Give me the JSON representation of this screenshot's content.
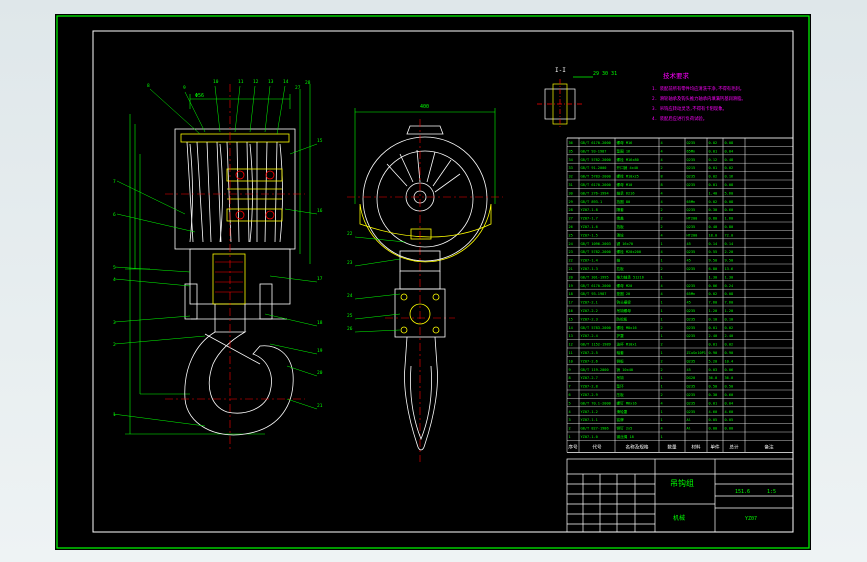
{
  "colors": {
    "background": "#000000",
    "outer_frame": "#00ff00",
    "inner_frame": "#ffffff",
    "geometry": "#ffffff",
    "dims": "#00ff00",
    "centerline": "#ff0000",
    "leader": "#00ff00",
    "title": "#00ff00",
    "tech": "#ff00ff",
    "highlight": "#ffff00",
    "section": "#ffffff"
  },
  "section_label": "I-I",
  "tech_requirements": {
    "title": "技术要求",
    "items": [
      "1. 装配前所有零件均应清洗干净,不得有毛刺。",
      "2. 滑轮轴承及钩头推力轴承内填满钙基润滑脂。",
      "3. 吊钩应转动灵活,不得有卡阻现象。",
      "4. 装配后应进行负荷试验。"
    ]
  },
  "bom": {
    "headers": [
      "序号",
      "代号",
      "名称及规格",
      "数量",
      "材料",
      "单件",
      "总计",
      "备注"
    ],
    "weight_header": "重量",
    "rows": [
      {
        "no": "36",
        "code": "GB/T 6170-2000",
        "name": "螺母 M16",
        "qty": "4",
        "mat": "Q235",
        "unit": "0.02",
        "total": "0.08"
      },
      {
        "no": "35",
        "code": "GB/T 93-1987",
        "name": "垫圈 16",
        "qty": "4",
        "mat": "65Mn",
        "unit": "0.01",
        "total": "0.04"
      },
      {
        "no": "34",
        "code": "GB/T 5782-2000",
        "name": "螺栓 M16x80",
        "qty": "4",
        "mat": "Q235",
        "unit": "0.12",
        "total": "0.48"
      },
      {
        "no": "33",
        "code": "GB/T 91-2000",
        "name": "开口销 4x40",
        "qty": "2",
        "mat": "Q215",
        "unit": "0.01",
        "total": "0.02"
      },
      {
        "no": "32",
        "code": "GB/T 5783-2000",
        "name": "螺栓 M10x25",
        "qty": "8",
        "mat": "Q235",
        "unit": "0.02",
        "total": "0.16"
      },
      {
        "no": "31",
        "code": "GB/T 6170-2000",
        "name": "螺母 M10",
        "qty": "8",
        "mat": "Q235",
        "unit": "0.01",
        "total": "0.08"
      },
      {
        "no": "30",
        "code": "GB/T 276-1994",
        "name": "轴承 6216",
        "qty": "4",
        "mat": "",
        "unit": "1.40",
        "total": "5.60"
      },
      {
        "no": "29",
        "code": "GB/T 893.1",
        "name": "挡圈 80",
        "qty": "4",
        "mat": "65Mn",
        "unit": "0.02",
        "total": "0.08"
      },
      {
        "no": "28",
        "code": "YZ07-1.8",
        "name": "隔套",
        "qty": "2",
        "mat": "Q235",
        "unit": "0.30",
        "total": "0.60"
      },
      {
        "no": "27",
        "code": "YZ07-1.7",
        "name": "端盖",
        "qty": "2",
        "mat": "HT200",
        "unit": "0.80",
        "total": "1.60"
      },
      {
        "no": "26",
        "code": "YZ07-1.6",
        "name": "挡板",
        "qty": "2",
        "mat": "Q235",
        "unit": "0.40",
        "total": "0.80"
      },
      {
        "no": "25",
        "code": "YZ07-1.5",
        "name": "滑轮",
        "qty": "4",
        "mat": "HT200",
        "unit": "18.0",
        "total": "72.0"
      },
      {
        "no": "24",
        "code": "GB/T 1096-2003",
        "name": "键 16x70",
        "qty": "1",
        "mat": "45",
        "unit": "0.14",
        "total": "0.14"
      },
      {
        "no": "23",
        "code": "GB/T 5782-2000",
        "name": "螺栓 M20x200",
        "qty": "4",
        "mat": "Q235",
        "unit": "0.55",
        "total": "2.20"
      },
      {
        "no": "22",
        "code": "YZ07-1.4",
        "name": "轴",
        "qty": "1",
        "mat": "45",
        "unit": "9.50",
        "total": "9.50"
      },
      {
        "no": "21",
        "code": "YZ07-1.3",
        "name": "拉板",
        "qty": "2",
        "mat": "Q235",
        "unit": "6.80",
        "total": "13.6"
      },
      {
        "no": "20",
        "code": "GB/T 301-1995",
        "name": "推力轴承 51216",
        "qty": "1",
        "mat": "",
        "unit": "1.30",
        "total": "1.30"
      },
      {
        "no": "19",
        "code": "GB/T 6170-2000",
        "name": "螺母 M20",
        "qty": "4",
        "mat": "Q235",
        "unit": "0.06",
        "total": "0.24"
      },
      {
        "no": "18",
        "code": "GB/T 93-1987",
        "name": "垫圈 20",
        "qty": "4",
        "mat": "65Mn",
        "unit": "0.02",
        "total": "0.08"
      },
      {
        "no": "17",
        "code": "YZ07-2.1",
        "name": "钩头横梁",
        "qty": "1",
        "mat": "45",
        "unit": "7.60",
        "total": "7.60"
      },
      {
        "no": "16",
        "code": "YZ07-2.2",
        "name": "吊钩螺母",
        "qty": "1",
        "mat": "Q235",
        "unit": "1.20",
        "total": "1.20"
      },
      {
        "no": "15",
        "code": "YZ07-2.3",
        "name": "防松板",
        "qty": "1",
        "mat": "Q235",
        "unit": "0.10",
        "total": "0.10"
      },
      {
        "no": "14",
        "code": "GB/T 5783-2000",
        "name": "螺栓 M8x16",
        "qty": "2",
        "mat": "Q235",
        "unit": "0.01",
        "total": "0.02"
      },
      {
        "no": "13",
        "code": "YZ07-2.4",
        "name": "护罩",
        "qty": "1",
        "mat": "Q235",
        "unit": "2.40",
        "total": "2.40"
      },
      {
        "no": "12",
        "code": "GB/T 1152-1989",
        "name": "油杯 M10x1",
        "qty": "2",
        "mat": "",
        "unit": "0.01",
        "total": "0.02"
      },
      {
        "no": "11",
        "code": "YZ07-2.5",
        "name": "轴套",
        "qty": "1",
        "mat": "ZCuSn10P1",
        "unit": "0.90",
        "total": "0.90"
      },
      {
        "no": "10",
        "code": "YZ07-2.6",
        "name": "侧板",
        "qty": "2",
        "mat": "Q235",
        "unit": "5.20",
        "total": "10.4"
      },
      {
        "no": "9",
        "code": "GB/T 119-2000",
        "name": "销 10x40",
        "qty": "2",
        "mat": "45",
        "unit": "0.03",
        "total": "0.06"
      },
      {
        "no": "8",
        "code": "YZ07-2.7",
        "name": "吊钩",
        "qty": "1",
        "mat": "DG20",
        "unit": "36.0",
        "total": "36.0"
      },
      {
        "no": "7",
        "code": "YZ07-2.8",
        "name": "垫环",
        "qty": "1",
        "mat": "Q235",
        "unit": "0.50",
        "total": "0.50"
      },
      {
        "no": "6",
        "code": "YZ07-2.9",
        "name": "压板",
        "qty": "2",
        "mat": "Q235",
        "unit": "0.30",
        "total": "0.60"
      },
      {
        "no": "5",
        "code": "GB/T 70.1-2000",
        "name": "螺钉 M6x16",
        "qty": "4",
        "mat": "Q235",
        "unit": "0.01",
        "total": "0.04"
      },
      {
        "no": "4",
        "code": "YZ07-1.2",
        "name": "滑轮罩",
        "qty": "1",
        "mat": "Q235",
        "unit": "4.60",
        "total": "4.60"
      },
      {
        "no": "3",
        "code": "YZ07-1.1",
        "name": "铭牌",
        "qty": "1",
        "mat": "Al",
        "unit": "0.05",
        "total": "0.05"
      },
      {
        "no": "2",
        "code": "GB/T 827-1986",
        "name": "铆钉 2x5",
        "qty": "4",
        "mat": "Al",
        "unit": "0.00",
        "total": "0.00"
      },
      {
        "no": "1",
        "code": "YZ07-1.0",
        "name": "钢丝绳 18",
        "qty": "1",
        "mat": "",
        "unit": "",
        "total": ""
      }
    ]
  },
  "title_block": {
    "drawing_name": "吊钩组",
    "company": "机械",
    "labels": [
      "标记",
      "处数",
      "分区",
      "更改文件号",
      "签名",
      "年月日"
    ],
    "stage_labels": [
      "阶段标记",
      "重量",
      "比例"
    ],
    "weight": "151.6",
    "scale": "1:5",
    "drawing_no": "YZ07"
  },
  "callouts_left": [
    "1",
    "2",
    "3",
    "4",
    "5",
    "6",
    "7",
    "8",
    "9",
    "10",
    "11",
    "12",
    "13",
    "14",
    "15",
    "16",
    "17",
    "18",
    "19",
    "20",
    "21",
    "22",
    "23",
    "24",
    "25",
    "26",
    "27",
    "28"
  ],
  "callouts_right": [
    "29",
    "30",
    "31",
    "32",
    "33",
    "34",
    "35",
    "36"
  ],
  "dimensions": {
    "top_width": "400",
    "hook_top": "Φ56"
  }
}
